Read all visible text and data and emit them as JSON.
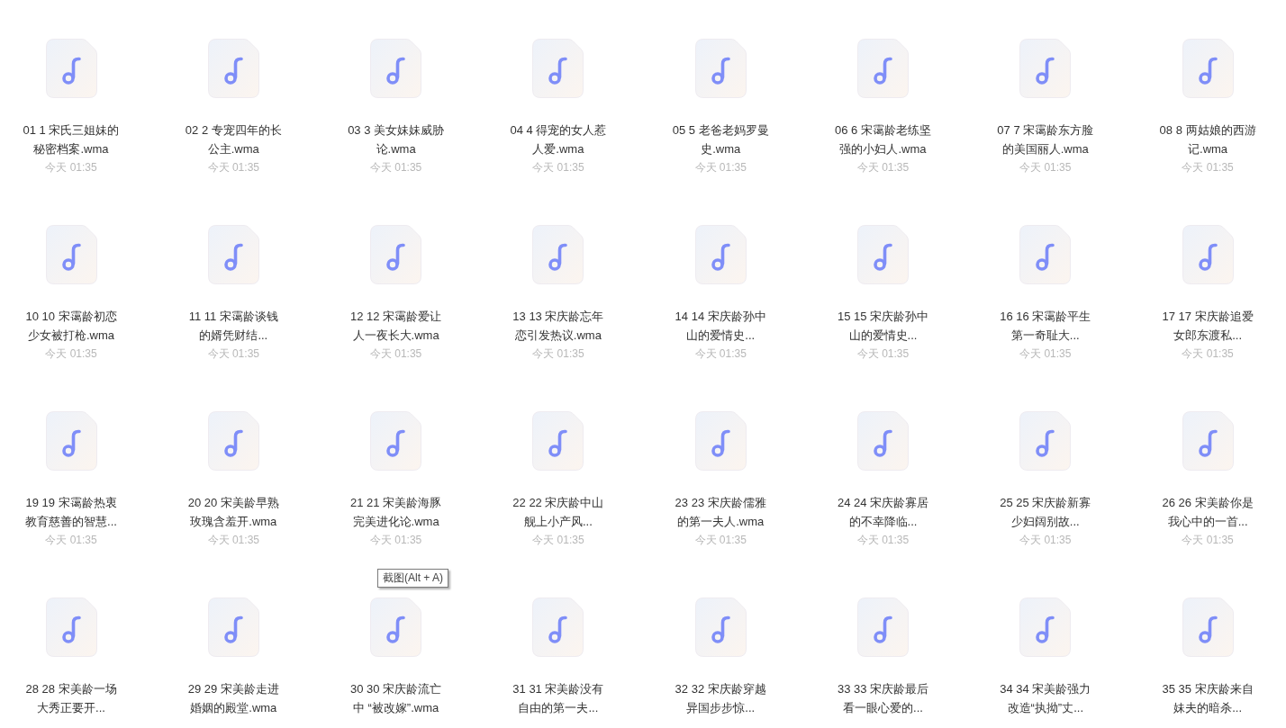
{
  "files": [
    {
      "name_lines": [
        "01 1 宋氏三姐妹的",
        "秘密档案.wma"
      ],
      "time": "今天 01:35"
    },
    {
      "name_lines": [
        "02 2 专宠四年的长",
        "公主.wma"
      ],
      "time": "今天 01:35"
    },
    {
      "name_lines": [
        "03 3 美女妹妹威胁",
        "论.wma"
      ],
      "time": "今天 01:35"
    },
    {
      "name_lines": [
        "04 4 得宠的女人惹",
        "人爱.wma"
      ],
      "time": "今天 01:35"
    },
    {
      "name_lines": [
        "05 5 老爸老妈罗曼",
        "史.wma"
      ],
      "time": "今天 01:35"
    },
    {
      "name_lines": [
        "06 6 宋霭龄老练坚",
        "强的小妇人.wma"
      ],
      "time": "今天 01:35"
    },
    {
      "name_lines": [
        "07 7 宋霭龄东方脸",
        "的美国丽人.wma"
      ],
      "time": "今天 01:35"
    },
    {
      "name_lines": [
        "08 8 两姑娘的西游",
        "记.wma"
      ],
      "time": "今天 01:35"
    },
    {
      "name_lines": [
        "10 10 宋霭龄初恋",
        "少女被打枪.wma"
      ],
      "time": "今天 01:35"
    },
    {
      "name_lines": [
        "11 11 宋霭龄谈钱",
        "的婿凭财结..."
      ],
      "time": "今天 01:35"
    },
    {
      "name_lines": [
        "12 12 宋霭龄爱让",
        "人一夜长大.wma"
      ],
      "time": "今天 01:35"
    },
    {
      "name_lines": [
        "13 13 宋庆龄忘年",
        "恋引发热议.wma"
      ],
      "time": "今天 01:35"
    },
    {
      "name_lines": [
        "14 14 宋庆龄孙中",
        "山的爱情史..."
      ],
      "time": "今天 01:35"
    },
    {
      "name_lines": [
        "15 15 宋庆龄孙中",
        "山的爱情史..."
      ],
      "time": "今天 01:35"
    },
    {
      "name_lines": [
        "16 16 宋霭龄平生",
        "第一奇耻大..."
      ],
      "time": "今天 01:35"
    },
    {
      "name_lines": [
        "17 17 宋庆龄追爱",
        "女郎东渡私..."
      ],
      "time": "今天 01:35"
    },
    {
      "name_lines": [
        "19 19 宋霭龄热衷",
        "教育慈善的智慧..."
      ],
      "time": "今天 01:35"
    },
    {
      "name_lines": [
        "20 20 宋美龄早熟",
        "玫瑰含羞开.wma"
      ],
      "time": "今天 01:35"
    },
    {
      "name_lines": [
        "21 21 宋美龄海豚",
        "完美进化论.wma"
      ],
      "time": "今天 01:35"
    },
    {
      "name_lines": [
        "22 22 宋庆龄中山",
        "舰上小产风..."
      ],
      "time": "今天 01:35"
    },
    {
      "name_lines": [
        "23 23 宋庆龄儒雅",
        "的第一夫人.wma"
      ],
      "time": "今天 01:35"
    },
    {
      "name_lines": [
        "24 24 宋庆龄寡居",
        "的不幸降临..."
      ],
      "time": "今天 01:35"
    },
    {
      "name_lines": [
        "25 25 宋庆龄新寡",
        "少妇阔别故..."
      ],
      "time": "今天 01:35"
    },
    {
      "name_lines": [
        "26 26 宋美龄你是",
        "我心中的一首..."
      ],
      "time": "今天 01:35"
    },
    {
      "name_lines": [
        "28 28 宋美龄一场",
        "大秀正要开..."
      ]
    },
    {
      "name_lines": [
        "29 29 宋美龄走进",
        "婚姻的殿堂.wma"
      ]
    },
    {
      "name_lines": [
        "30 30 宋庆龄流亡",
        "中 “被改嫁”.wma"
      ]
    },
    {
      "name_lines": [
        "31 31 宋美龄没有",
        "自由的第一夫..."
      ]
    },
    {
      "name_lines": [
        "32 32 宋庆龄穿越",
        "异国步步惊..."
      ]
    },
    {
      "name_lines": [
        "33 33 宋庆龄最后",
        "看一眼心爱的..."
      ]
    },
    {
      "name_lines": [
        "34 34 宋美龄强力",
        "改造“执拗”丈..."
      ]
    },
    {
      "name_lines": [
        "35 35 宋庆龄来自",
        "妹夫的暗杀..."
      ]
    }
  ],
  "tooltip": {
    "text": "截图(Alt + A)"
  }
}
